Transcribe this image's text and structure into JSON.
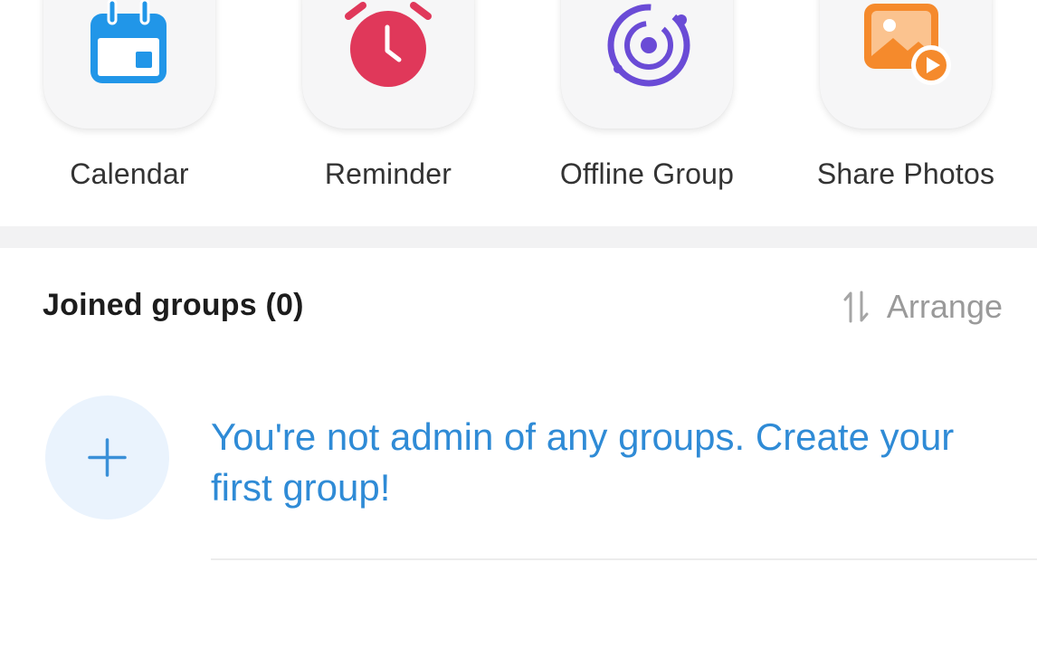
{
  "apps": [
    {
      "label": "Calendar",
      "icon": "calendar-icon"
    },
    {
      "label": "Reminder",
      "icon": "alarm-clock-icon"
    },
    {
      "label": "Offline Group",
      "icon": "orbit-icon"
    },
    {
      "label": "Share Photos",
      "icon": "photo-share-icon"
    }
  ],
  "joined_groups": {
    "title": "Joined groups (0)",
    "arrange_label": "Arrange",
    "arrange_icon": "sort-arrows-icon"
  },
  "empty_state": {
    "message": "You're not admin of any groups. Create your first group!",
    "icon": "plus-icon"
  },
  "colors": {
    "calendar_blue": "#2196e8",
    "reminder_red": "#e0385a",
    "offline_purple": "#6a4bd6",
    "photos_orange": "#f58a2c",
    "link_blue": "#2f8bd6",
    "create_circle_bg": "#eaf3fd"
  }
}
